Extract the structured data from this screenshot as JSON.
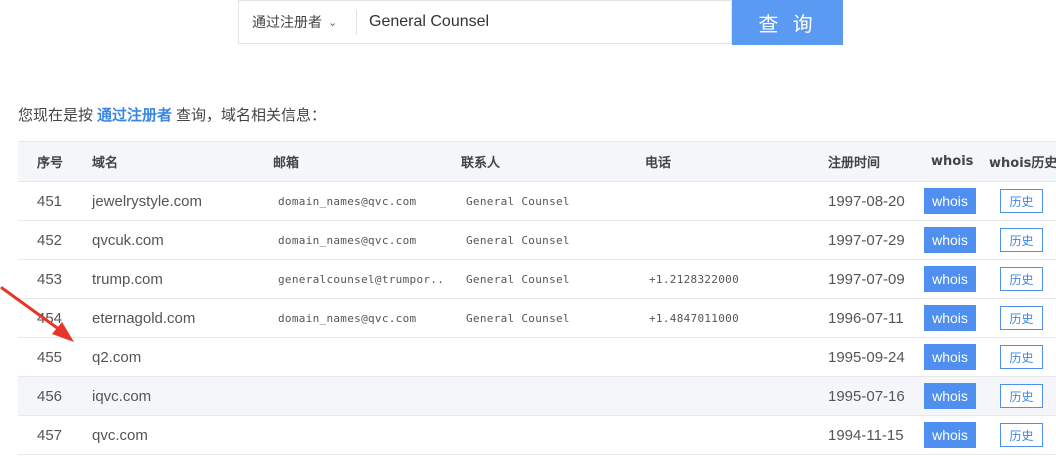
{
  "search": {
    "type_label": "通过注册者",
    "query": "General Counsel",
    "button_label": "查 询"
  },
  "info": {
    "prefix": "您现在是按",
    "mode": "通过注册者",
    "suffix": "查询，域名相关信息："
  },
  "table": {
    "headers": {
      "no": "序号",
      "domain": "域名",
      "email": "邮箱",
      "contact": "联系人",
      "phone": "电话",
      "reg_date": "注册时间",
      "whois": "whois",
      "history": "whois历史"
    },
    "rows": [
      {
        "no": "451",
        "domain": "jewelrystyle.com",
        "email": "domain_names@qvc.com",
        "contact": "General Counsel",
        "phone": "",
        "reg_date": "1997-08-20",
        "whois_label": "whois",
        "history_label": "历史"
      },
      {
        "no": "452",
        "domain": "qvcuk.com",
        "email": "domain_names@qvc.com",
        "contact": "General Counsel",
        "phone": "",
        "reg_date": "1997-07-29",
        "whois_label": "whois",
        "history_label": "历史"
      },
      {
        "no": "453",
        "domain": "trump.com",
        "email": "generalcounsel@trumpor..",
        "contact": "General Counsel",
        "phone": "+1.2128322000",
        "reg_date": "1997-07-09",
        "whois_label": "whois",
        "history_label": "历史"
      },
      {
        "no": "454",
        "domain": "eternagold.com",
        "email": "domain_names@qvc.com",
        "contact": "General Counsel",
        "phone": "+1.4847011000",
        "reg_date": "1996-07-11",
        "whois_label": "whois",
        "history_label": "历史"
      },
      {
        "no": "455",
        "domain": "q2.com",
        "email": "",
        "contact": "",
        "phone": "",
        "reg_date": "1995-09-24",
        "whois_label": "whois",
        "history_label": "历史"
      },
      {
        "no": "456",
        "domain": "iqvc.com",
        "email": "",
        "contact": "",
        "phone": "",
        "reg_date": "1995-07-16",
        "whois_label": "whois",
        "history_label": "历史"
      },
      {
        "no": "457",
        "domain": "qvc.com",
        "email": "",
        "contact": "",
        "phone": "",
        "reg_date": "1994-11-15",
        "whois_label": "whois",
        "history_label": "历史"
      }
    ]
  },
  "colors": {
    "accent": "#5b9af2",
    "button": "#4f8ff0",
    "highlight_text": "#3a86e6",
    "annotation_arrow": "#e8352b"
  }
}
